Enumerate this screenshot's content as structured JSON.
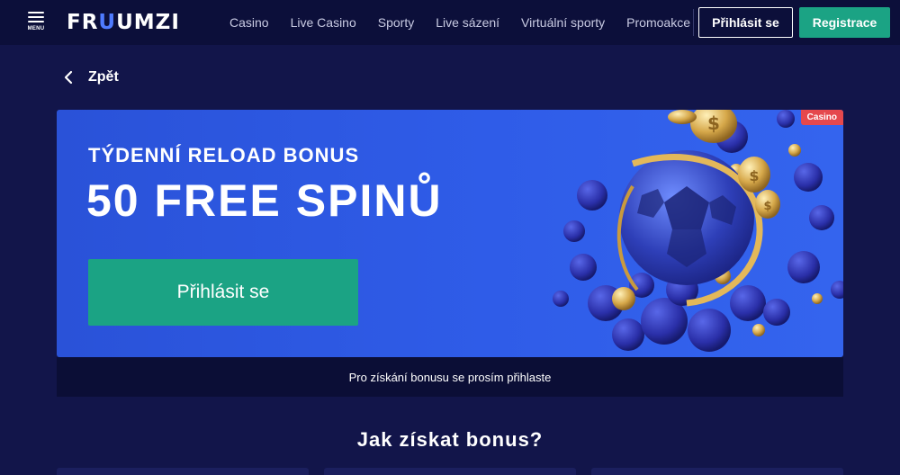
{
  "header": {
    "menu_label": "MENU",
    "logo": {
      "part1": "FR",
      "part2": "U",
      "part3": "UMZI"
    },
    "nav": [
      "Casino",
      "Live Casino",
      "Sporty",
      "Live sázení",
      "Virtuální sporty",
      "Promoakce"
    ],
    "login_label": "Přihlásit se",
    "register_label": "Registrace"
  },
  "back_label": "Zpět",
  "promo": {
    "badge": "Casino",
    "subtitle": "TÝDENNÍ RELOAD BONUS",
    "title": "50 FREE SPINŮ",
    "cta_label": "Přihlásit se",
    "notice": "Pro získání bonusu se prosím přihlaste"
  },
  "section_title": "Jak získat bonus?",
  "colors": {
    "page_bg": "#12154a",
    "header_bg": "#0c0f3a",
    "card_blue": "#2f5ce8",
    "accent_green": "#1ba384",
    "badge_red": "#e5484d",
    "logo_blue": "#4f7bff"
  },
  "icons": {
    "menu": "hamburger-icon",
    "back": "chevron-left-icon"
  }
}
